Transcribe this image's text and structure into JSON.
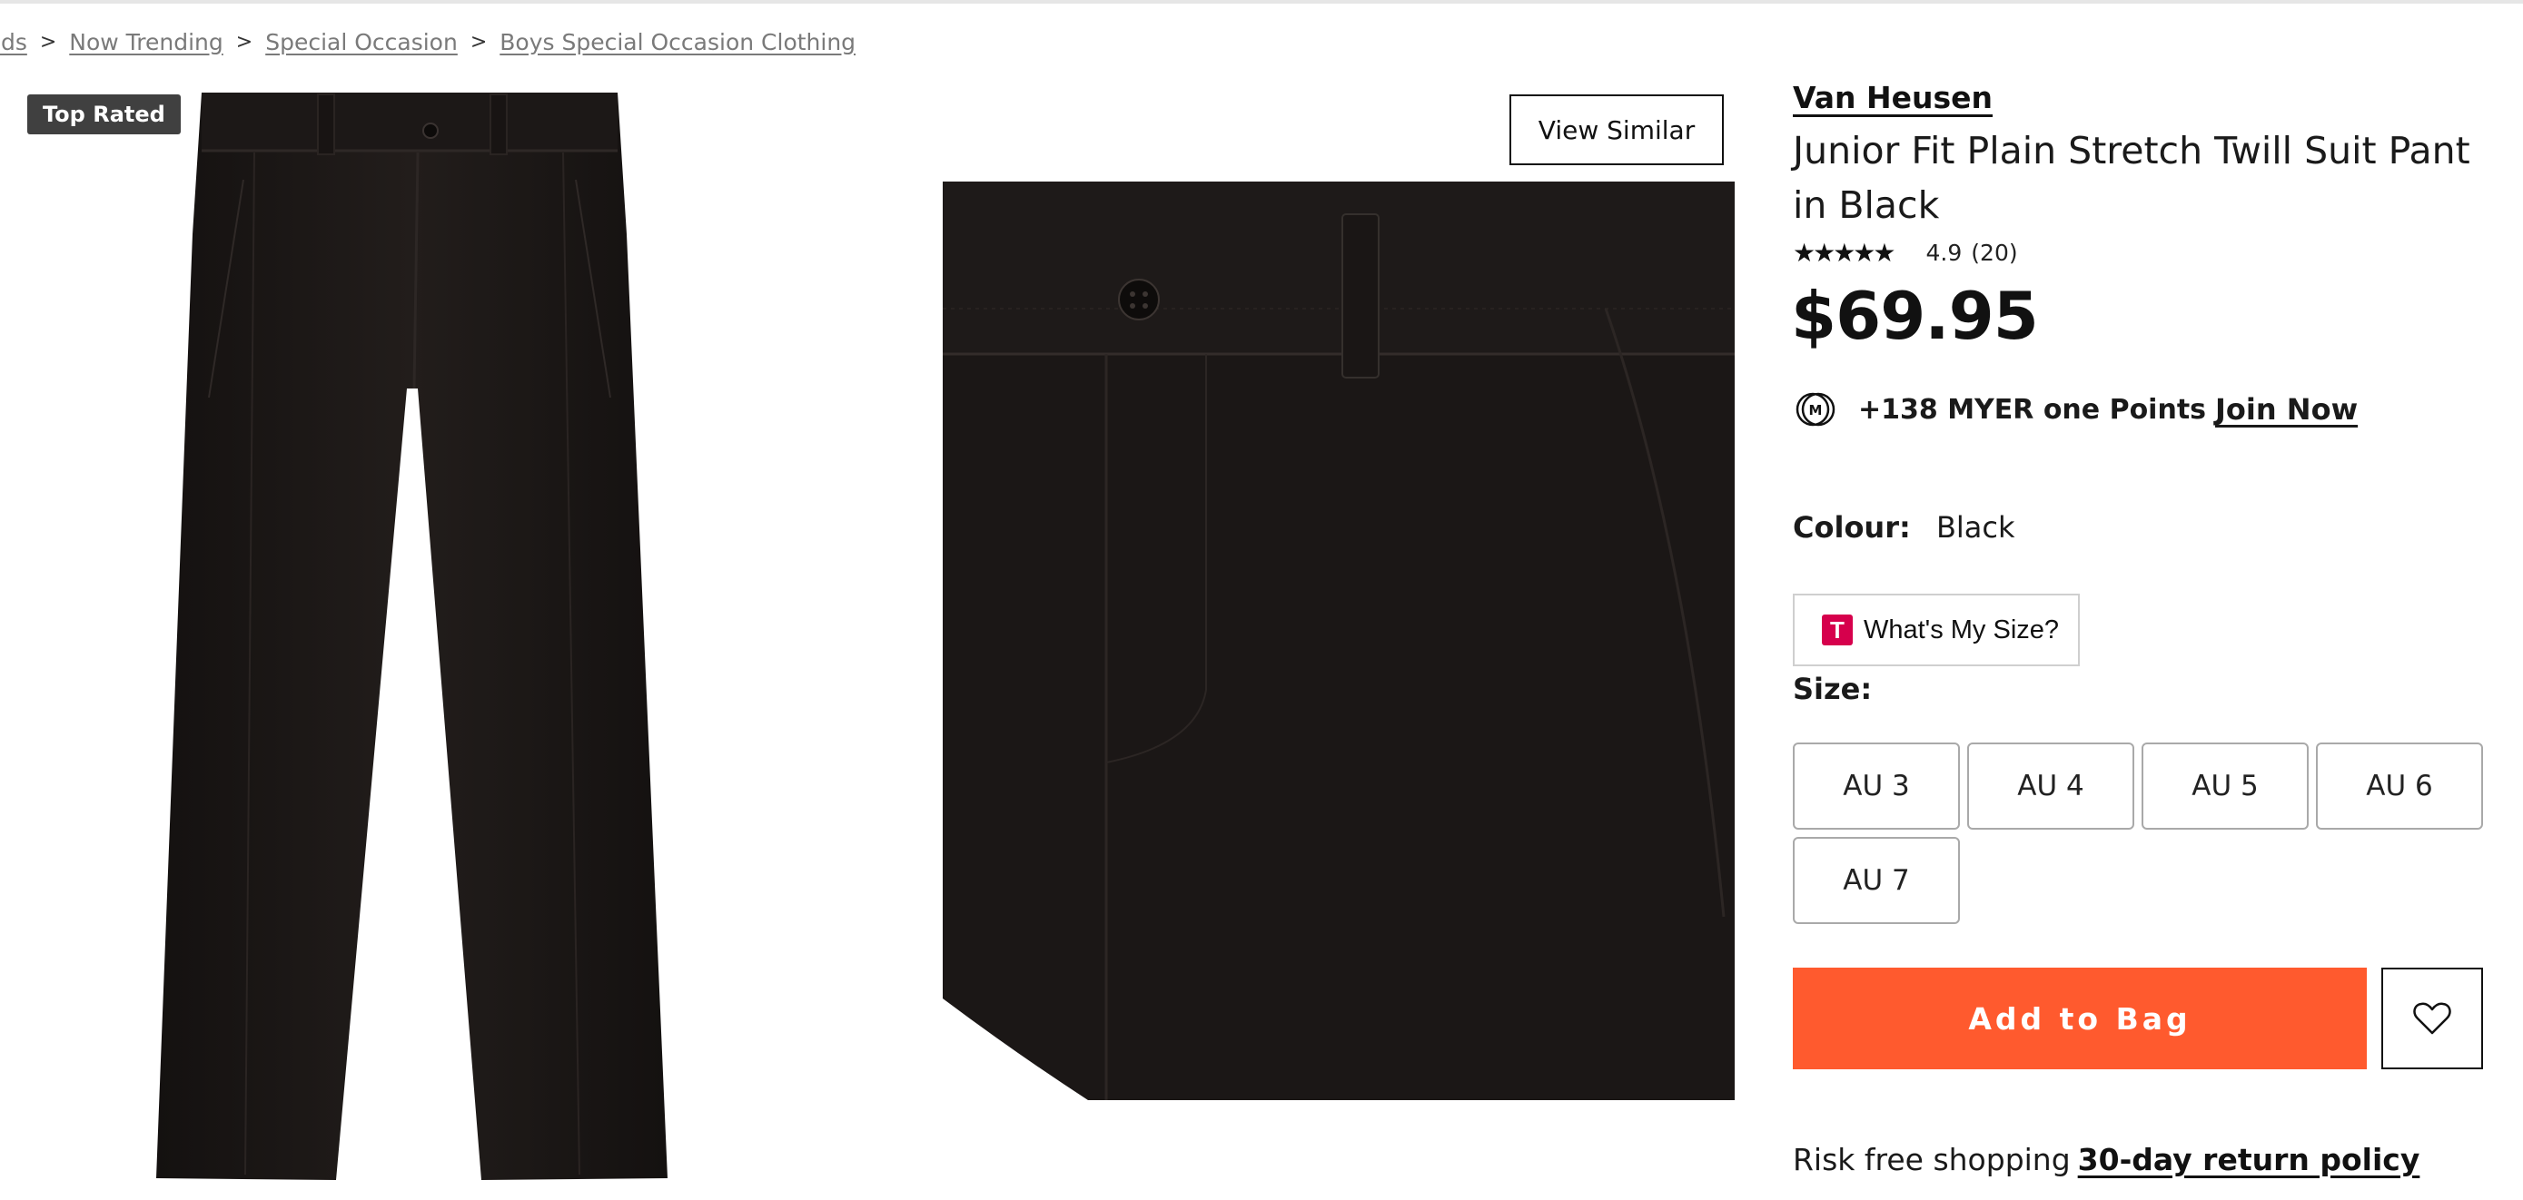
{
  "breadcrumb": {
    "items": [
      "ids",
      "Now Trending",
      "Special Occasion",
      "Boys Special Occasion Clothing"
    ],
    "separator": ">"
  },
  "gallery": {
    "badge": "Top Rated",
    "view_similar": "View Similar"
  },
  "product": {
    "brand": "Van Heusen",
    "title": "Junior Fit Plain Stretch Twill Suit Pant in Black",
    "rating_stars": "★★★★★",
    "rating_value": "4.9",
    "review_count": "(20)",
    "price": "$69.95",
    "points_text": "+138 MYER one Points",
    "points_link": "Join Now",
    "colour_label": "Colour:",
    "colour_value": "Black",
    "whats_my_size": "What's My Size?",
    "whats_my_size_logo": "T",
    "size_label": "Size:",
    "sizes": [
      "AU 3",
      "AU 4",
      "AU 5",
      "AU 6",
      "AU 7"
    ],
    "add_to_bag": "Add to Bag",
    "risk_text": "Risk free shopping",
    "return_link": "30-day return policy"
  },
  "colors": {
    "accent": "#ff5a2e",
    "badge_bg": "#404040",
    "trueFit": "#d6004c"
  },
  "icons": {
    "wishlist": "heart-icon",
    "points": "myer-m-icon"
  }
}
